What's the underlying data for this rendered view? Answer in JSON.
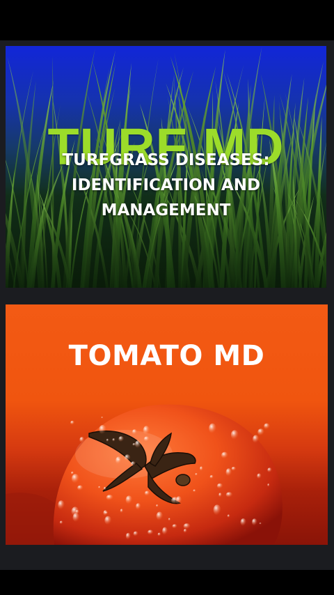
{
  "cards": [
    {
      "title": "TURF MD",
      "subtitle_lines": [
        "TURFGRASS DISEASES:",
        "IDENTIFICATION AND",
        "MANAGEMENT"
      ],
      "accent_color": "#9cdc2a",
      "background_image": "grass-photo"
    },
    {
      "title": "TOMATO MD",
      "accent_color": "#f35a14",
      "background_image": "tomato-photo"
    }
  ]
}
